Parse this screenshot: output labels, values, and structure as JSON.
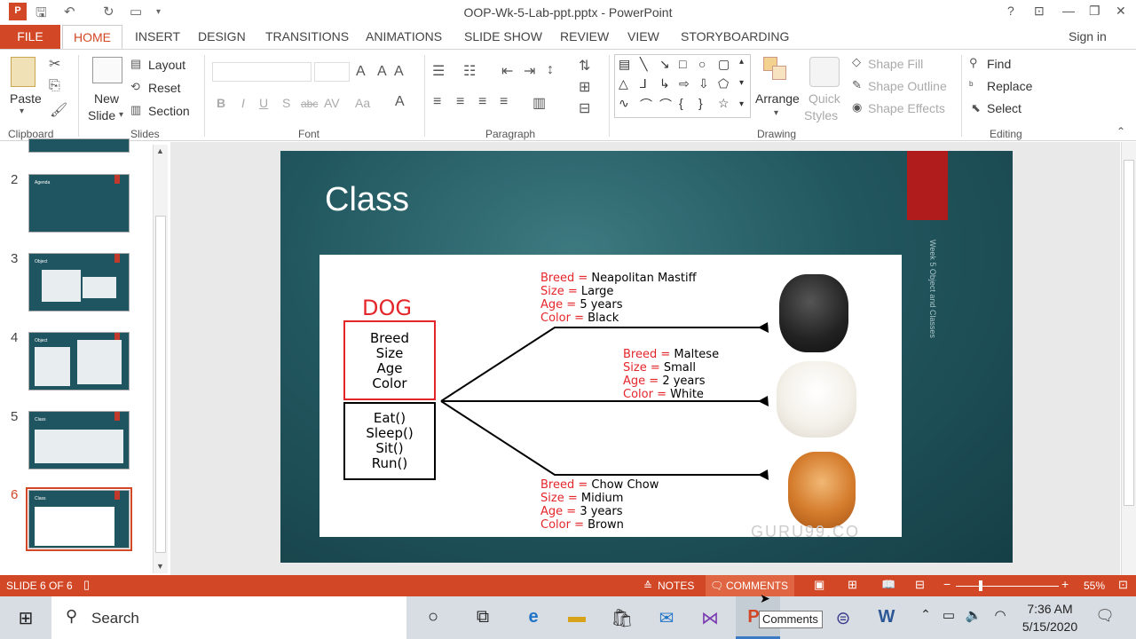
{
  "window": {
    "title": "OOP-Wk-5-Lab-ppt.pptx - PowerPoint",
    "help": "?",
    "controls": [
      "🗗",
      "—",
      "🗖",
      "✕"
    ]
  },
  "ribbon_tabs": [
    "FILE",
    "HOME",
    "INSERT",
    "DESIGN",
    "TRANSITIONS",
    "ANIMATIONS",
    "SLIDE SHOW",
    "REVIEW",
    "VIEW",
    "STORYBOARDING"
  ],
  "sign_in": "Sign in",
  "clipboard": {
    "paste": "Paste",
    "label": "Clipboard"
  },
  "slides_group": {
    "new_slide_1": "New",
    "new_slide_2": "Slide",
    "layout": "Layout",
    "reset": "Reset",
    "section": "Section",
    "label": "Slides"
  },
  "font_group": {
    "label": "Font",
    "bold": "B",
    "italic": "I",
    "underline": "U",
    "shadow": "S",
    "strike": "abc",
    "spacing": "AV",
    "case": "Aa"
  },
  "paragraph_group": {
    "label": "Paragraph"
  },
  "drawing_group": {
    "label": "Drawing",
    "arrange": "Arrange",
    "quick_styles_1": "Quick",
    "quick_styles_2": "Styles",
    "shape_fill": "Shape Fill",
    "shape_outline": "Shape Outline",
    "shape_effects": "Shape Effects"
  },
  "editing_group": {
    "label": "Editing",
    "find": "Find",
    "replace": "Replace",
    "select": "Select"
  },
  "thumbnails": [
    {
      "num": "2",
      "title": "Agenda"
    },
    {
      "num": "3",
      "title": "Object"
    },
    {
      "num": "4",
      "title": "Object"
    },
    {
      "num": "5",
      "title": "Class"
    },
    {
      "num": "6",
      "title": "Class"
    }
  ],
  "slide": {
    "title": "Class",
    "side_text": "Week 5 Object and Classes",
    "class_name": "DOG",
    "attributes": [
      "Breed",
      "Size",
      "Age",
      "Color"
    ],
    "methods": [
      "Eat()",
      "Sleep()",
      "Sit()",
      "Run()"
    ],
    "objects": [
      {
        "breed": "Neapolitan Mastiff",
        "size": "Large",
        "age": "5 years",
        "color": "Black"
      },
      {
        "breed": "Maltese",
        "size": "Small",
        "age": "2 years",
        "color": "White"
      },
      {
        "breed": "Chow Chow",
        "size": "Midium",
        "age": "3 years",
        "color": "Brown"
      }
    ],
    "keys": {
      "breed": "Breed =",
      "size": "Size =",
      "age": "Age =",
      "color": "Color ="
    },
    "watermark": "GURU99.CO"
  },
  "status": {
    "slide_info": "SLIDE 6 OF 6",
    "notes": "NOTES",
    "comments": "COMMENTS",
    "zoom": "55%"
  },
  "taskbar": {
    "search": "Search",
    "time": "7:36 AM",
    "date": "5/15/2020"
  },
  "tooltip": "Comments"
}
